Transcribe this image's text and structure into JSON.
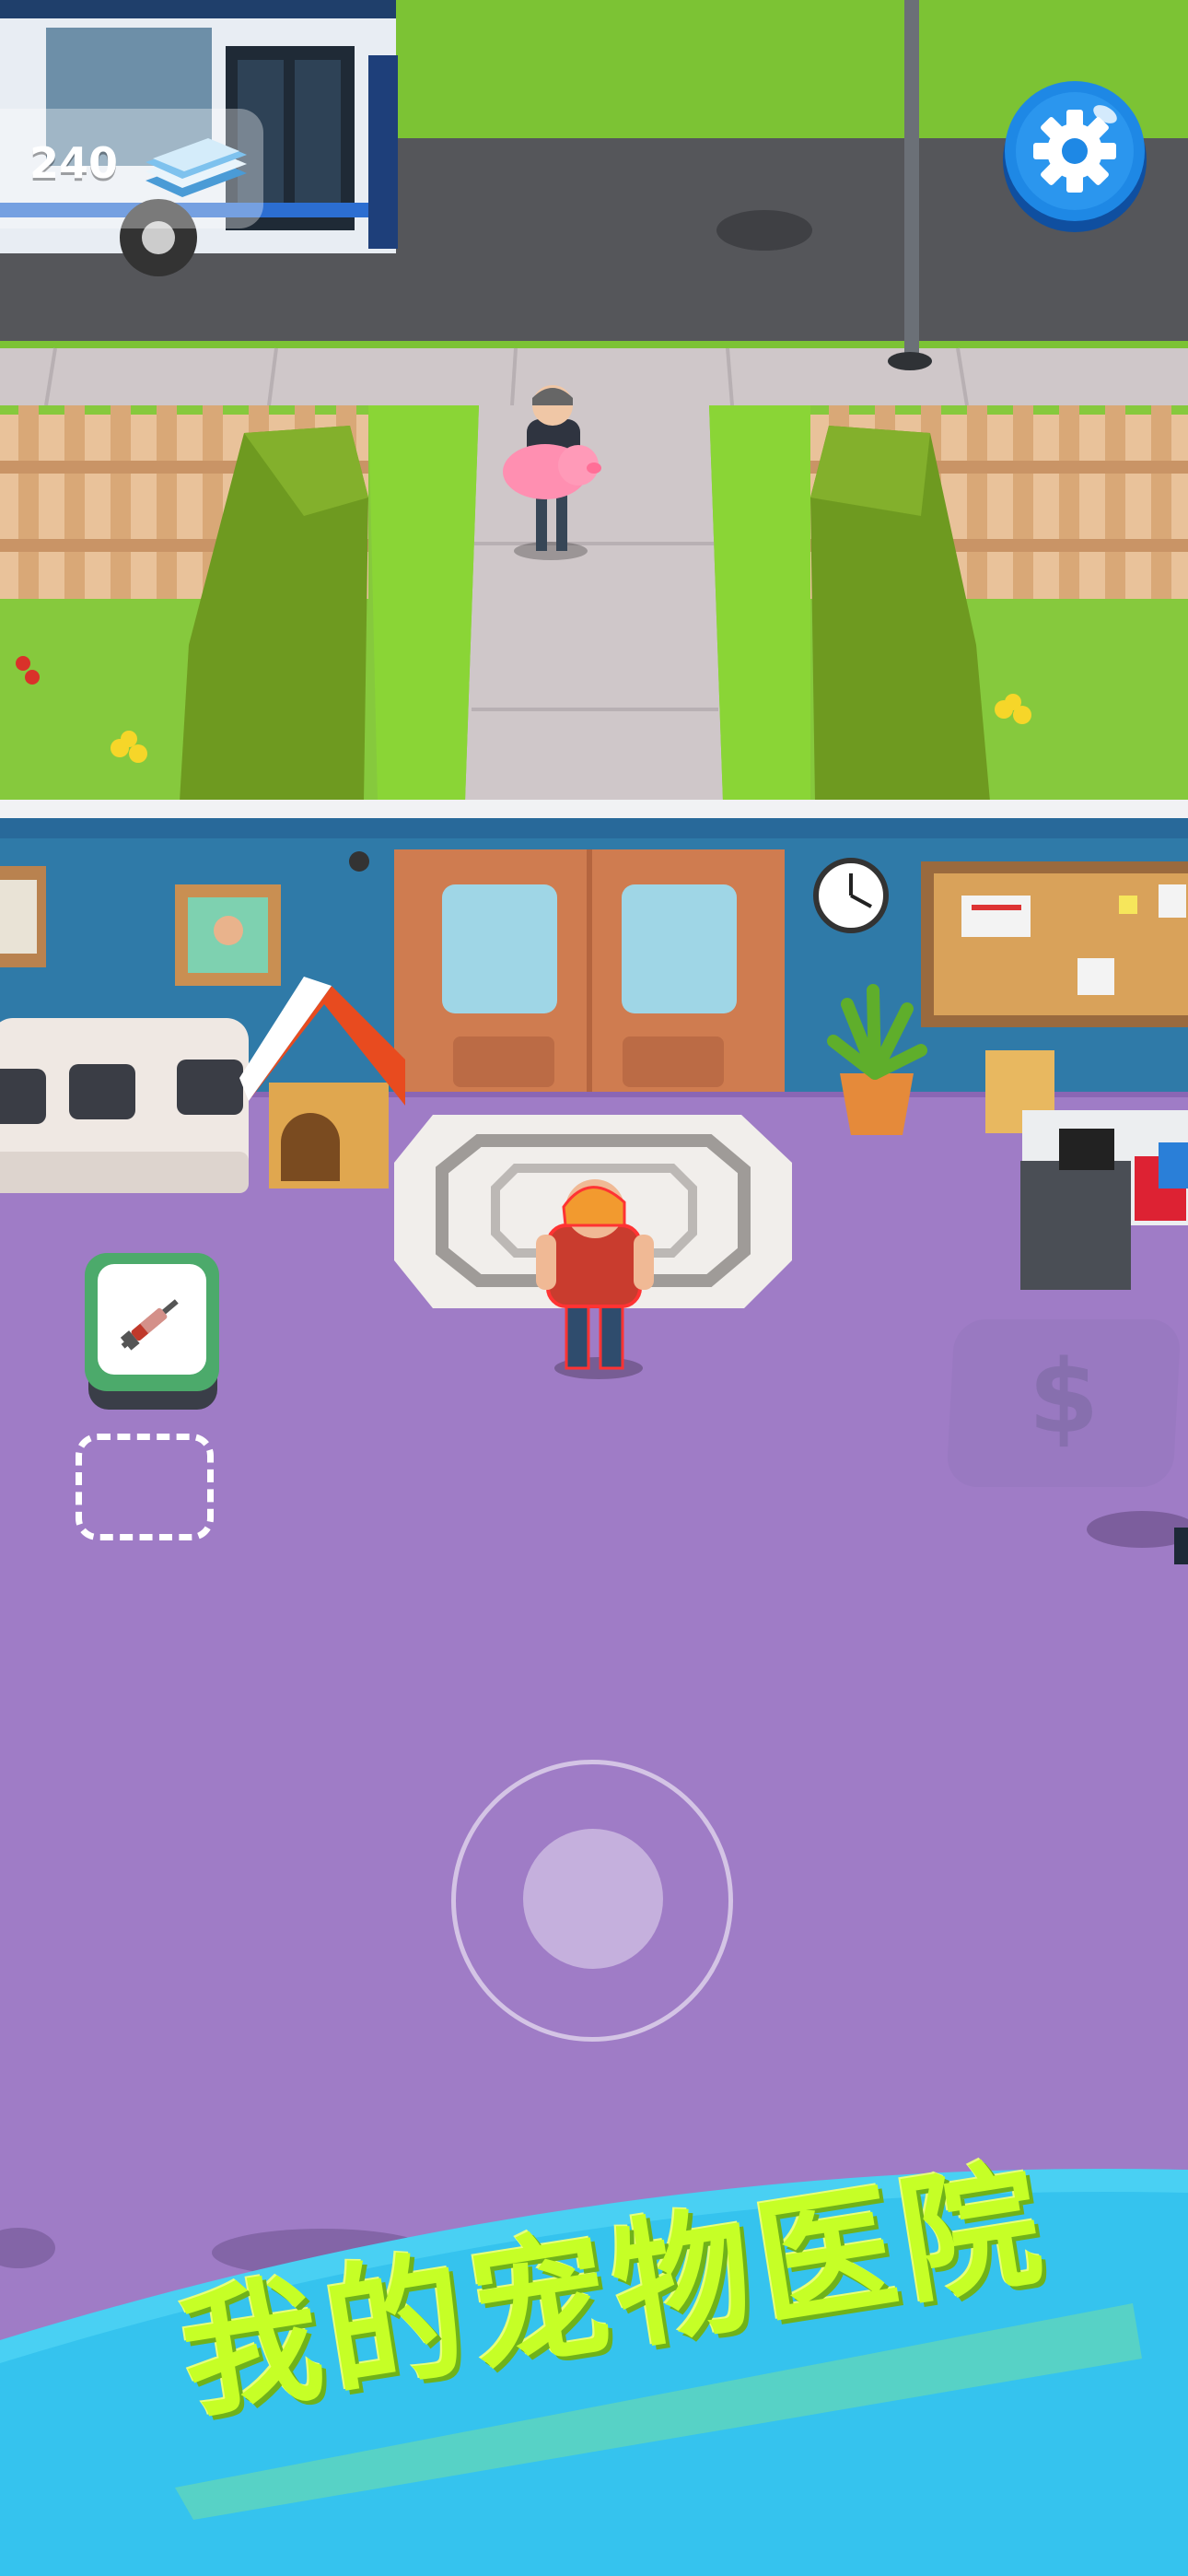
{
  "hud": {
    "money": "240",
    "money_icon": "cash-stack-icon",
    "settings_icon": "gear-icon"
  },
  "station": {
    "zone_label": "$",
    "vaccine_icon": "syringe-icon"
  },
  "banner": {
    "title": "我的宠物医院"
  },
  "colors": {
    "floor": "#9f7cc6",
    "wall": "#2f7aa8",
    "grass": "#7cc334",
    "road": "#5a5a5d",
    "banner": "#35c3ee",
    "title": "#c6ff26",
    "settings_button": "#1e88e5"
  }
}
